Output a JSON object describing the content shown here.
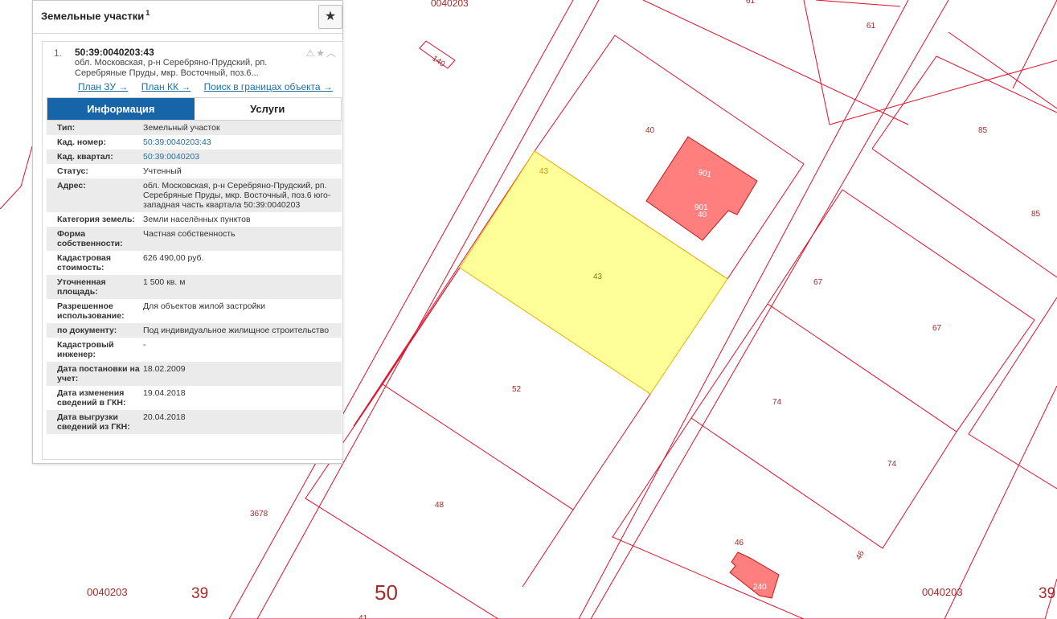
{
  "panel": {
    "title": "Земельные участки",
    "count": "1",
    "favorite_icon": "star-icon"
  },
  "item": {
    "number": "1.",
    "cadastral_number": "50:39:0040203:43",
    "address_short": "обл. Московская, р-н Серебряно-Прудский, рп. Серебряные Пруды, мкр. Восточный, поз.6...",
    "icons": [
      "warning-icon",
      "star-icon",
      "collapse-icon"
    ]
  },
  "links": {
    "plan_zu": "План ЗУ →",
    "plan_kk": "План КК →",
    "search": "Поиск в границах объекта →"
  },
  "tabs": {
    "info": "Информация",
    "services": "Услуги"
  },
  "info_rows": [
    {
      "label": "Тип:",
      "value": "Земельный участок"
    },
    {
      "label": "Кад. номер:",
      "value": "50:39:0040203:43"
    },
    {
      "label": "Кад. квартал:",
      "value": "50:39:0040203"
    },
    {
      "label": "Статус:",
      "value": "Учтенный"
    },
    {
      "label": "Адрес:",
      "value": "обл. Московская, р-н Серебряно-Прудский, рп. Серебряные Пруды, мкр. Восточный, поз.6 юго-западная часть квартала 50:39:0040203"
    },
    {
      "label": "Категория земель:",
      "value": "Земли населённых пунктов"
    },
    {
      "label": "Форма собственности:",
      "value": "Частная собственность"
    },
    {
      "label": "Кадастровая стоимость:",
      "value": "626 490,00 руб."
    },
    {
      "label": "Уточненная площадь:",
      "value": "1 500 кв. м"
    },
    {
      "label": "Разрешенное использование:",
      "value": "Для объектов жилой застройки"
    },
    {
      "label": "по документу:",
      "value": "Под индивидуальное жилищное строительство"
    },
    {
      "label": "Кадастровый инженер:",
      "value": "-"
    },
    {
      "label": "Дата постановки на учет:",
      "value": "18.02.2009"
    },
    {
      "label": "Дата изменения сведений в ГКН:",
      "value": "19.04.2018"
    },
    {
      "label": "Дата выгрузки сведений из ГКН:",
      "value": "20.04.2018"
    }
  ],
  "map_labels": {
    "l_0040203_top": "0040203",
    "l_61_top": "61",
    "l_61": "61",
    "l_140": "140",
    "l_40": "40",
    "l_85_a": "85",
    "l_85_b": "85",
    "l_901_a": "901",
    "l_901_b": "901",
    "l_40_b": "40",
    "l_43_a": "43",
    "l_43_b": "43",
    "l_67_a": "67",
    "l_67_b": "67",
    "l_52": "52",
    "l_74_a": "74",
    "l_74_b": "74",
    "l_48": "48",
    "l_3678": "3678",
    "l_46_a": "46",
    "l_46_b": "46",
    "l_240": "240",
    "l_0040203_left": "0040203",
    "l_39_left": "39",
    "l_50": "50",
    "l_0040203_right": "0040203",
    "l_39_right": "39",
    "l_41": "41"
  },
  "colors": {
    "parcel_line": "#e0102a",
    "selected_fill": "#ffff99",
    "building_fill": "#ff7f7f",
    "label": "#a52a2a",
    "accent": "#1565a8"
  }
}
